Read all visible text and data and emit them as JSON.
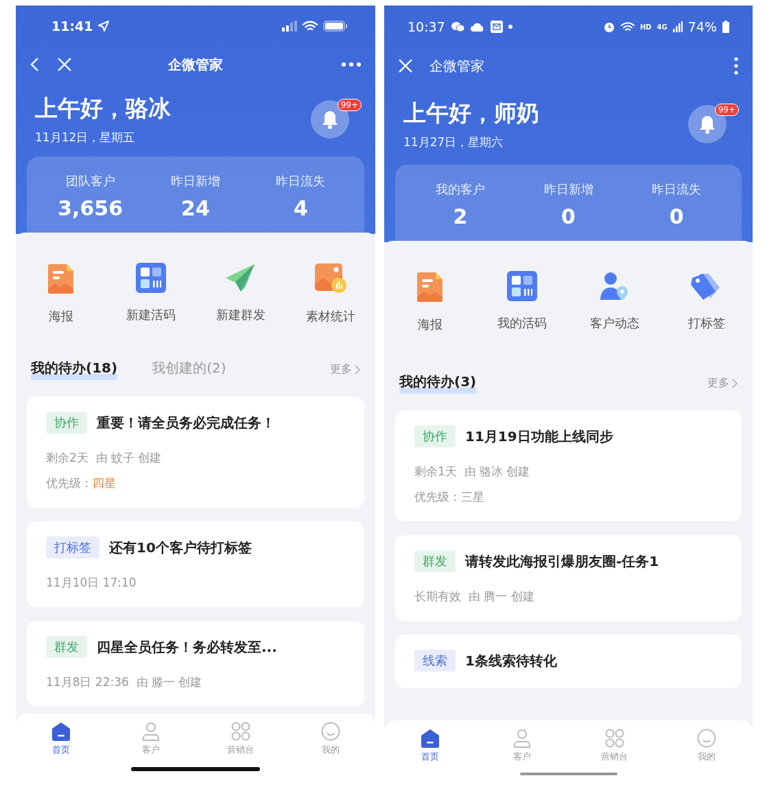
{
  "phones": [
    {
      "kind": "ios",
      "status_bar": {
        "time": "11:41"
      },
      "nav": {
        "title": "企微管家"
      },
      "greeting": "上午好，骆冰",
      "date": "11月12日，星期五",
      "badge": "99+",
      "stats": [
        {
          "label": "团队客户",
          "value": "3,656"
        },
        {
          "label": "昨日新增",
          "value": "24"
        },
        {
          "label": "昨日流失",
          "value": "4"
        }
      ],
      "shortcuts": [
        {
          "label": "海报",
          "kind": "poster"
        },
        {
          "label": "新建活码",
          "kind": "qrcode"
        },
        {
          "label": "新建群发",
          "kind": "send"
        },
        {
          "label": "素材统计",
          "kind": "material"
        }
      ],
      "todo_tabs": [
        {
          "label": "我的待办(18)",
          "selected": true
        },
        {
          "label": "我创建的(2)",
          "selected": false
        }
      ],
      "more": "更多",
      "tasks": [
        {
          "tag": "协作",
          "color": "#3aa864",
          "title": "重要！请全员务必完成任务！",
          "meta": "剩余2天  由 蚊子 创建",
          "priority": {
            "label": "优先级：",
            "value": "四星",
            "highlight": true
          }
        },
        {
          "tag": "打标签",
          "color": "#4a6fe0",
          "title": "还有10个客户待打标签",
          "meta": "11月10日 17:10"
        },
        {
          "tag": "群发",
          "color": "#3aa864",
          "title": "四星全员任务！务必转发至...",
          "meta": "11月8日 22:36  由 滕一 创建"
        }
      ],
      "tab_bar": [
        {
          "label": "首页",
          "selected": true
        },
        {
          "label": "客户",
          "selected": false
        },
        {
          "label": "营销台",
          "selected": false
        },
        {
          "label": "我的",
          "selected": false
        }
      ]
    },
    {
      "kind": "android",
      "status_bar": {
        "time": "10:37",
        "network": "HD",
        "generation": "4G",
        "battery": "74%"
      },
      "nav": {
        "title": "企微管家"
      },
      "greeting": "上午好，师奶",
      "date": "11月27日，星期六",
      "badge": "99+",
      "stats": [
        {
          "label": "我的客户",
          "value": "2"
        },
        {
          "label": "昨日新增",
          "value": "0"
        },
        {
          "label": "昨日流失",
          "value": "0"
        }
      ],
      "shortcuts": [
        {
          "label": "海报",
          "kind": "poster"
        },
        {
          "label": "我的活码",
          "kind": "qrcode"
        },
        {
          "label": "客户动态",
          "kind": "customer"
        },
        {
          "label": "打标签",
          "kind": "tag"
        }
      ],
      "todo_tabs": [
        {
          "label": "我的待办(3)",
          "selected": true
        }
      ],
      "more": "更多",
      "tasks": [
        {
          "tag": "协作",
          "color": "#3aa864",
          "title": "11月19日功能上线同步",
          "meta": "剩余1天  由 骆冰 创建",
          "priority": {
            "label": "优先级：",
            "value": "三星",
            "highlight": false
          }
        },
        {
          "tag": "群发",
          "color": "#3aa864",
          "title": "请转发此海报引爆朋友圈-任务1",
          "meta": "长期有效  由 腾一 创建"
        },
        {
          "tag": "线索",
          "color": "#4a6fe0",
          "title": "1条线索待转化"
        }
      ],
      "tab_bar": [
        {
          "label": "首页",
          "selected": true
        },
        {
          "label": "客户",
          "selected": false
        },
        {
          "label": "营销台",
          "selected": false
        },
        {
          "label": "我的",
          "selected": false
        }
      ]
    }
  ]
}
